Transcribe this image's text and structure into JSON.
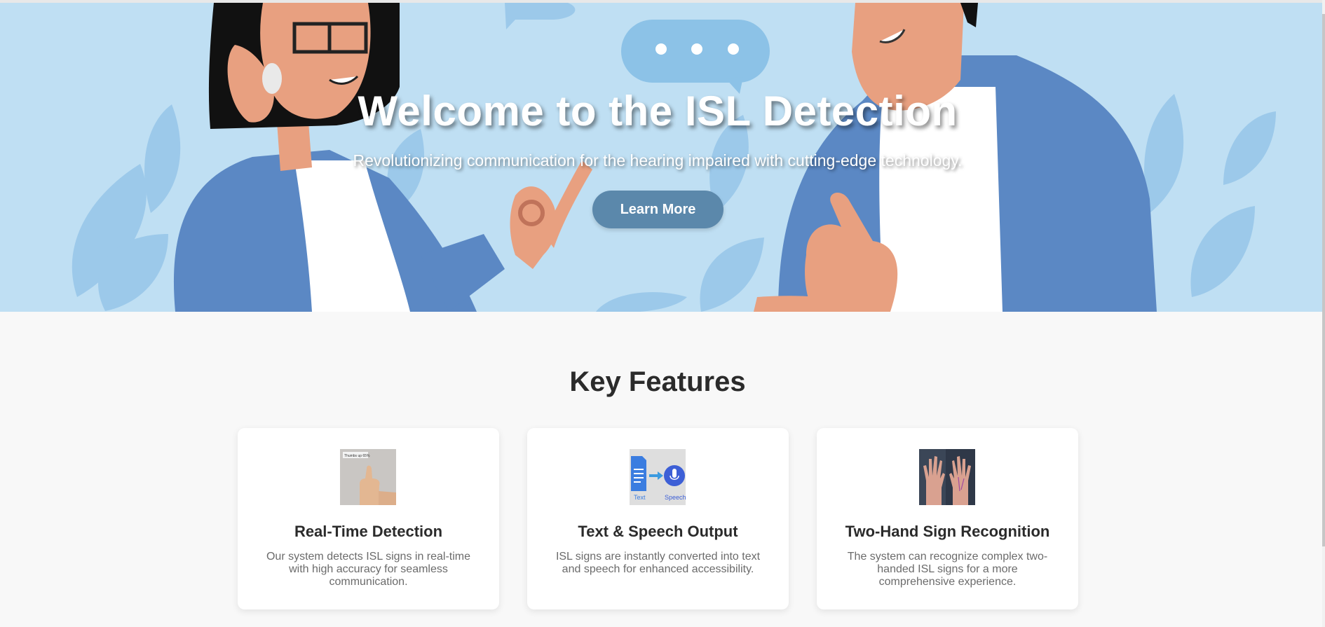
{
  "hero": {
    "title": "Welcome to the ISL Detection",
    "subtitle": "Revolutionizing communication for the hearing impaired with cutting-edge technology.",
    "cta_label": "Learn More"
  },
  "features": {
    "title": "Key Features",
    "cards": [
      {
        "heading": "Real-Time Detection",
        "description": "Our system detects ISL signs in real-time with high accuracy for seamless communication.",
        "image_caption": "Thumbs up 65%"
      },
      {
        "heading": "Text & Speech Output",
        "description": "ISL signs are instantly converted into text and speech for enhanced accessibility.",
        "image_text_label": "Text",
        "image_speech_label": "Speech"
      },
      {
        "heading": "Two-Hand Sign Recognition",
        "description": "The system can recognize complex two-handed ISL signs for a more comprehensive experience."
      }
    ]
  },
  "colors": {
    "hero_background": "#bfdff3",
    "cta_background": "#5b88ab",
    "jacket_blue": "#5b88c4",
    "skin": "#e8a080"
  }
}
